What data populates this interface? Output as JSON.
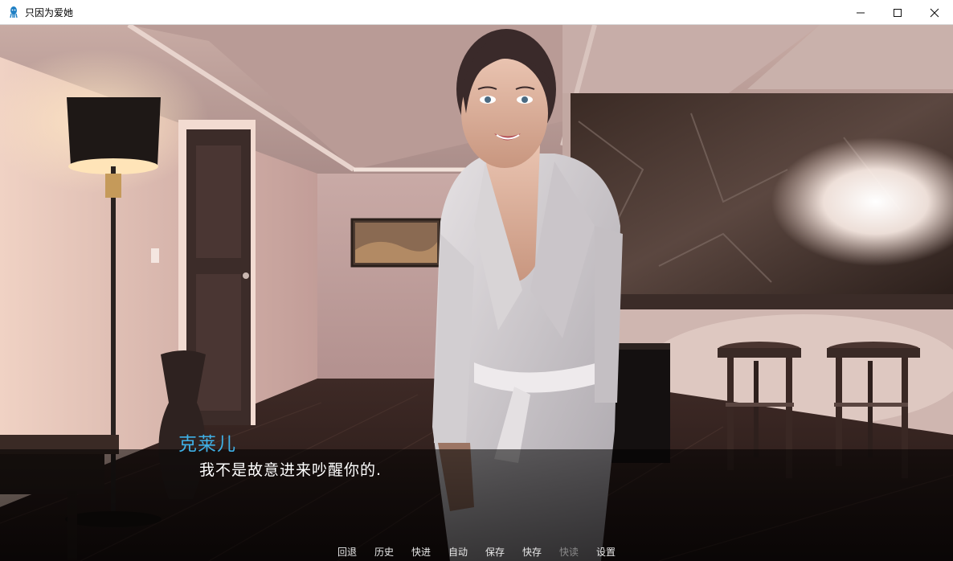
{
  "window": {
    "title": "只因为爱她",
    "icon": "squid-app-icon"
  },
  "controls": {
    "minimize_icon": "minimize-icon",
    "maximize_icon": "maximize-icon",
    "close_icon": "close-icon"
  },
  "dialogue": {
    "speaker": "克莱儿",
    "text": "我不是故意进来吵醒你的.",
    "speaker_color": "#3fb0e6"
  },
  "quick_menu": {
    "items": [
      {
        "label": "回退",
        "enabled": true
      },
      {
        "label": "历史",
        "enabled": true
      },
      {
        "label": "快进",
        "enabled": true
      },
      {
        "label": "自动",
        "enabled": true
      },
      {
        "label": "保存",
        "enabled": true
      },
      {
        "label": "快存",
        "enabled": true
      },
      {
        "label": "快读",
        "enabled": false
      },
      {
        "label": "设置",
        "enabled": true
      }
    ]
  }
}
